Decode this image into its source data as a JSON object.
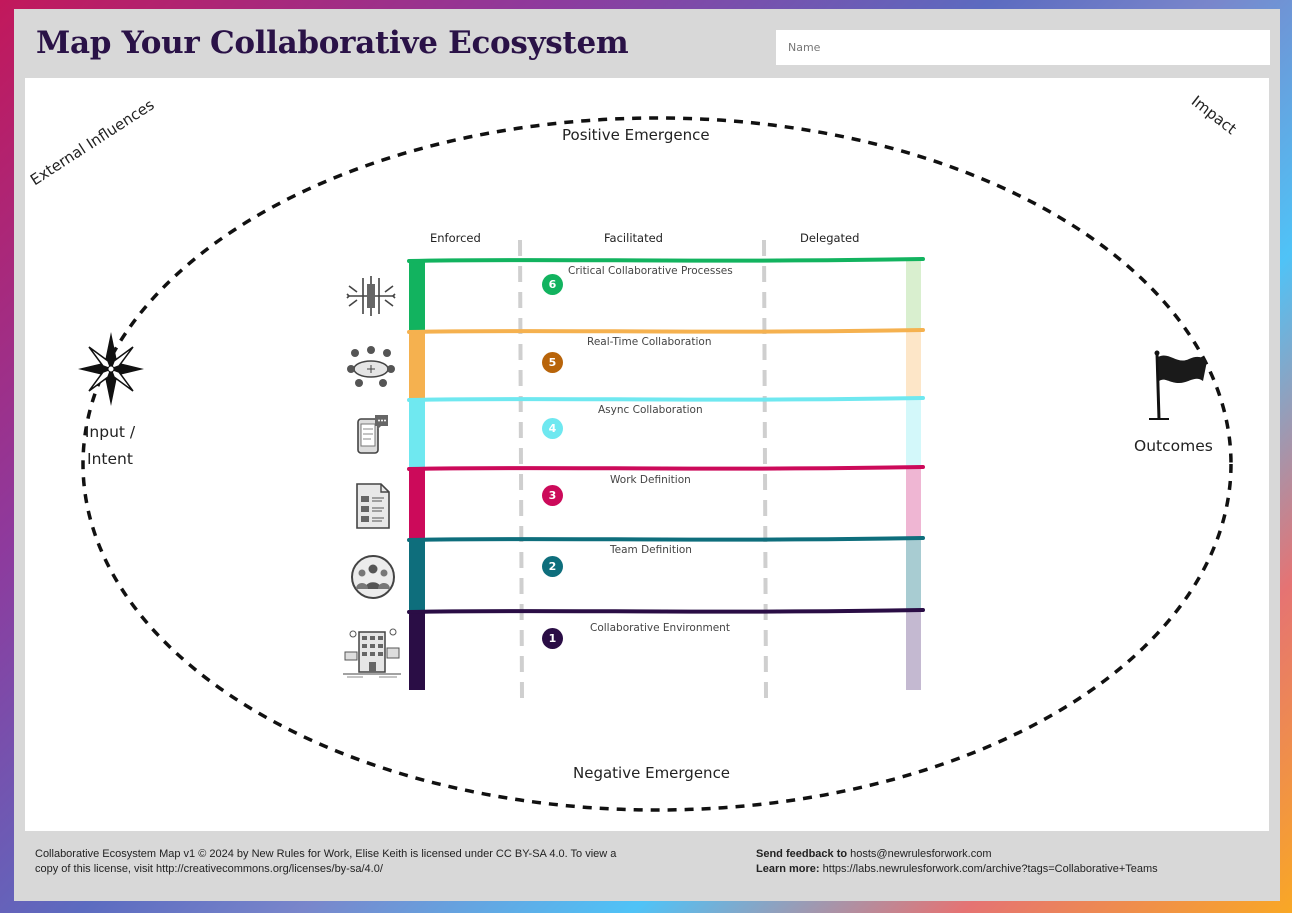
{
  "header": {
    "title": "Map Your Collaborative Ecosystem",
    "name_placeholder": "Name"
  },
  "map": {
    "corner_left": "External Influences",
    "corner_right": "Impact",
    "top_label": "Positive Emergence",
    "bottom_label": "Negative Emergence",
    "input_label_line1": "Input /",
    "input_label_line2": "Intent",
    "outcomes_label": "Outcomes",
    "columns": [
      "Enforced",
      "Facilitated",
      "Delegated"
    ],
    "layers": [
      {
        "number": "6",
        "label": "Critical Collaborative Processes",
        "color": "#12b35f",
        "pale": "#d9efcf",
        "icon": "process-arrows-icon"
      },
      {
        "number": "5",
        "label": "Real-Time Collaboration",
        "color": "#f5b14f",
        "pale": "#fde6c8",
        "icon": "meeting-table-icon",
        "badge_color": "#b8640a"
      },
      {
        "number": "4",
        "label": "Async Collaboration",
        "color": "#6fe8f0",
        "pale": "#d3f8fa",
        "icon": "phone-chat-icon"
      },
      {
        "number": "3",
        "label": "Work Definition",
        "color": "#cc0a5a",
        "pale": "#efb6d3",
        "icon": "document-icon"
      },
      {
        "number": "2",
        "label": "Team Definition",
        "color": "#0e6e7c",
        "pale": "#a8ccd2",
        "icon": "team-people-icon"
      },
      {
        "number": "1",
        "label": "Collaborative Environment",
        "color": "#2a0d45",
        "pale": "#c4b9d1",
        "icon": "office-building-icon"
      }
    ]
  },
  "footer": {
    "license_line1": "Collaborative Ecosystem Map v1 © 2024 by New Rules for Work, Elise Keith is licensed under CC BY-SA 4.0. To view a",
    "license_line2": "copy of this license, visit http://creativecommons.org/licenses/by-sa/4.0/",
    "feedback_label": "Send feedback to",
    "feedback_email": "hosts@newrulesforwork.com",
    "learn_label": "Learn more:",
    "learn_url": "https://labs.newrulesforwork.com/archive?tags=Collaborative+Teams"
  }
}
